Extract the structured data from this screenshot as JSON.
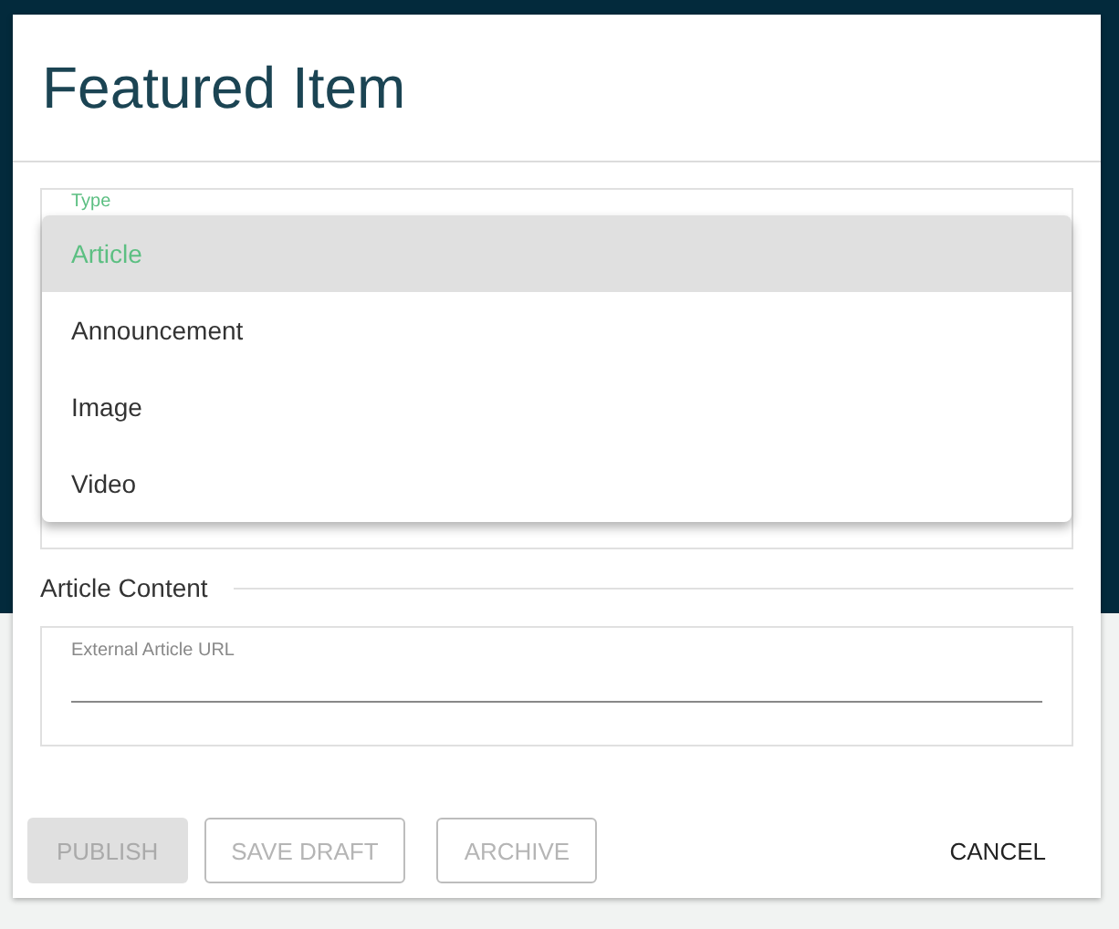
{
  "dialog": {
    "title": "Featured Item"
  },
  "type_field": {
    "label": "Type",
    "menu": [
      {
        "label": "Article",
        "selected": true
      },
      {
        "label": "Announcement",
        "selected": false
      },
      {
        "label": "Image",
        "selected": false
      },
      {
        "label": "Video",
        "selected": false
      }
    ]
  },
  "section": {
    "title": "Article Content"
  },
  "url_field": {
    "label": "External Article URL"
  },
  "buttons": [
    {
      "label": "PUBLISH",
      "kind": "filled",
      "disabled": true
    },
    {
      "label": "SAVE DRAFT",
      "kind": "outlined",
      "disabled": true
    },
    {
      "label": "ARCHIVE",
      "kind": "outlined",
      "disabled": true
    },
    {
      "label": "CANCEL",
      "kind": "text",
      "disabled": false
    }
  ]
}
